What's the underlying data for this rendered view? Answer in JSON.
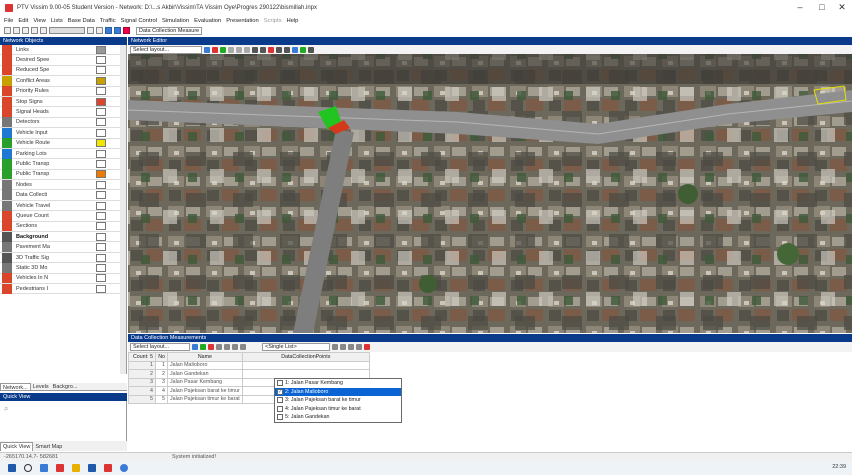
{
  "window": {
    "title": "PTV Vissim 9.00-05 Student Version - Network: D:\\...s Akbir\\Vissim\\TA Vissim Oye\\Progres 290122\\bismillah.inpx",
    "minimize": "–",
    "maximize": "□",
    "close": "✕"
  },
  "menu": {
    "items": [
      "File",
      "Edit",
      "View",
      "Lists",
      "Base Data",
      "Traffic",
      "Signal Control",
      "Simulation",
      "Evaluation",
      "Presentation",
      "Scripts",
      "Help"
    ]
  },
  "toolbar": {
    "dropdown_value": "Data Collection Measure"
  },
  "network_objects": {
    "title": "Network Objects",
    "items": [
      {
        "label": "Links",
        "color": "#d9462b",
        "swatch": "#999999"
      },
      {
        "label": "Desired Spee",
        "color": "#d9462b",
        "swatch": ""
      },
      {
        "label": "Reduced Spe",
        "color": "#d9462b",
        "swatch": ""
      },
      {
        "label": "Conflict Areas",
        "color": "#c8a000",
        "swatch": "#c8a000"
      },
      {
        "label": "Priority Rules",
        "color": "#d9462b",
        "swatch": ""
      },
      {
        "label": "Stop Signs",
        "color": "#d9462b",
        "swatch": "#d9462b"
      },
      {
        "label": "Signal Heads",
        "color": "#d9462b",
        "swatch": ""
      },
      {
        "label": "Detectors",
        "color": "#777777",
        "swatch": ""
      },
      {
        "label": "Vehicle Input",
        "color": "#1f78d1",
        "swatch": ""
      },
      {
        "label": "Vehicle Route",
        "color": "#2aa02a",
        "swatch": "#f2e600"
      },
      {
        "label": "Parking Lots",
        "color": "#1f78d1",
        "swatch": ""
      },
      {
        "label": "Public Transp",
        "color": "#2aa02a",
        "swatch": ""
      },
      {
        "label": "Public Transp",
        "color": "#2aa02a",
        "swatch": "#f07a00"
      },
      {
        "label": "Nodes",
        "color": "#777777",
        "swatch": ""
      },
      {
        "label": "Data Collecti",
        "color": "#777777",
        "swatch": ""
      },
      {
        "label": "Vehicle Travel",
        "color": "#777777",
        "swatch": ""
      },
      {
        "label": "Queue Count",
        "color": "#d9462b",
        "swatch": ""
      },
      {
        "label": "Sections",
        "color": "#d9462b",
        "swatch": ""
      },
      {
        "label": "Background",
        "color": "#555555",
        "swatch": "",
        "bold": true
      },
      {
        "label": "Pavement Ma",
        "color": "#777777",
        "swatch": ""
      },
      {
        "label": "3D Traffic Sig",
        "color": "#555555",
        "swatch": ""
      },
      {
        "label": "Static 3D Mo",
        "color": "#777777",
        "swatch": ""
      },
      {
        "label": "Vehicles In N",
        "color": "#d9462b",
        "swatch": ""
      },
      {
        "label": "Pedestrians I",
        "color": "#d9462b",
        "swatch": ""
      }
    ],
    "tabs": [
      "Network...",
      "Levels",
      "Backgro..."
    ]
  },
  "quick_view": {
    "title": "Quick View",
    "tabs": [
      "Quick View",
      "Smart Map"
    ]
  },
  "network_editor": {
    "title": "Network Editor",
    "select_layout": "Select layout..."
  },
  "data_collection": {
    "title": "Data Collection Measurements",
    "select_layout": "Select layout...",
    "single_list": "<Single List>",
    "columns": [
      "Count: 5",
      "No",
      "Name",
      "DataCollectionPoints"
    ],
    "rows": [
      {
        "no": "1",
        "name": "Jalan Malioboro"
      },
      {
        "no": "2",
        "name": "Jalan Gandekan"
      },
      {
        "no": "3",
        "name": "Jalan Pasar Kembang"
      },
      {
        "no": "4",
        "name": "Jalan Pajeksan barat ke timur"
      },
      {
        "no": "5",
        "name": "Jalan Pajeksan timur ke barat"
      }
    ],
    "dropdown_options": [
      {
        "label": "1: Jalan Pasar Kembang",
        "checked": false,
        "selected": false
      },
      {
        "label": "2: Jalan Malioboro",
        "checked": true,
        "selected": true
      },
      {
        "label": "3: Jalan Pajeksan barat ke timur",
        "checked": false,
        "selected": false
      },
      {
        "label": "4: Jalan Pajeksan timur ke barat",
        "checked": false,
        "selected": false
      },
      {
        "label": "5: Jalan Gandekan",
        "checked": false,
        "selected": false
      }
    ]
  },
  "status": {
    "coords": "-265170.14.7- 582681",
    "message": "System initialized!"
  },
  "taskbar": {
    "time": "22:39"
  }
}
